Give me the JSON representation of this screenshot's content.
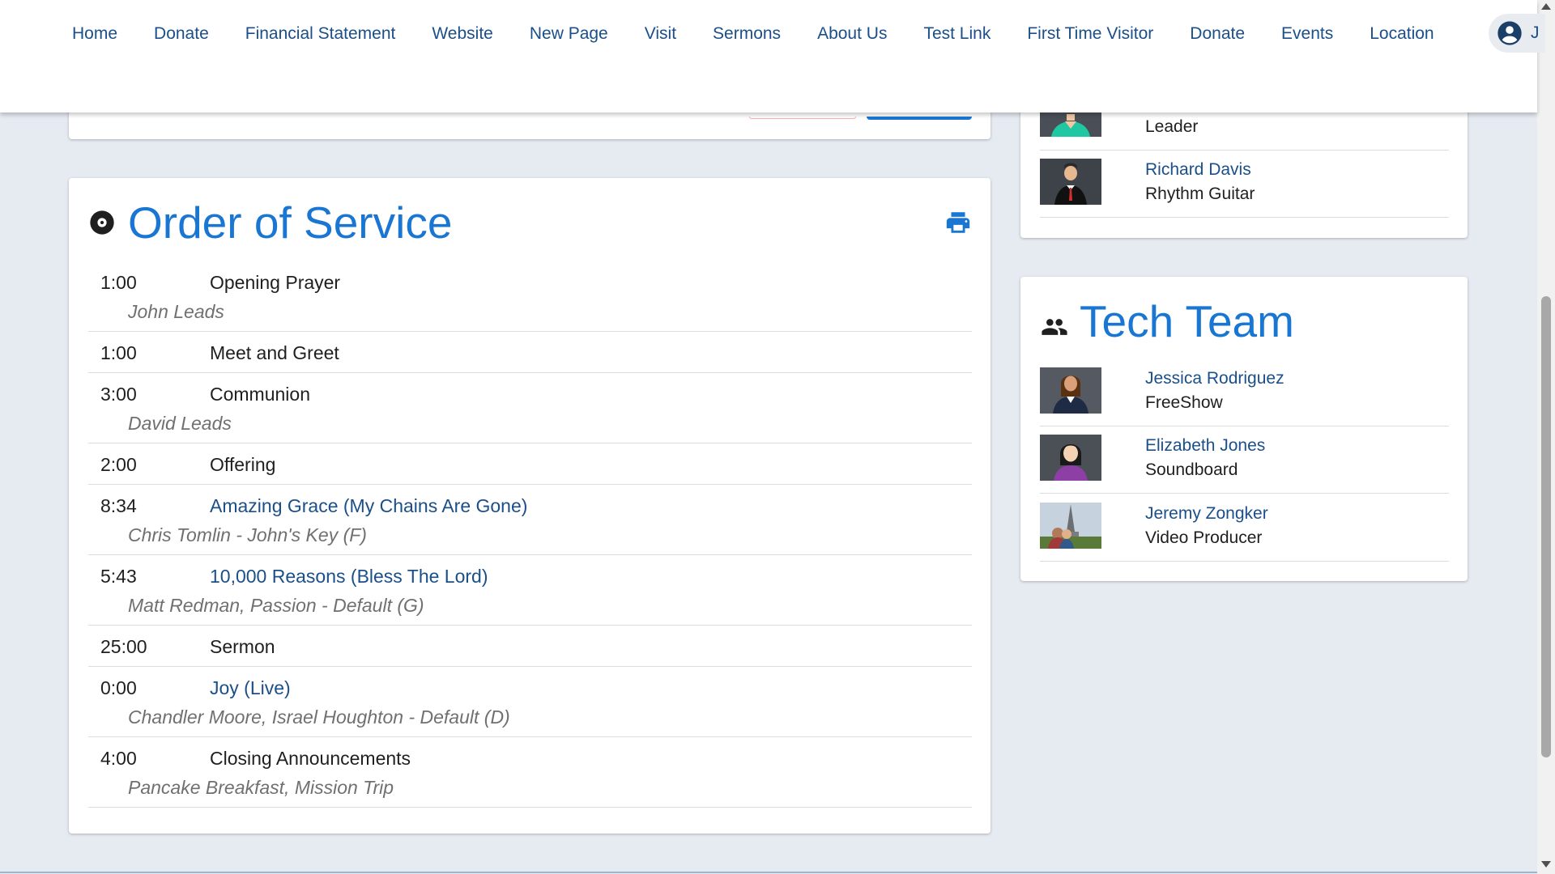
{
  "nav": {
    "items": [
      {
        "label": "Home"
      },
      {
        "label": "Donate"
      },
      {
        "label": "Financial Statement"
      },
      {
        "label": "Website"
      },
      {
        "label": "New Page"
      },
      {
        "label": "Visit"
      },
      {
        "label": "Sermons"
      },
      {
        "label": "About Us"
      },
      {
        "label": "Test Link"
      },
      {
        "label": "First Time Visitor"
      },
      {
        "label": "Donate"
      },
      {
        "label": "Events"
      },
      {
        "label": "Location"
      }
    ],
    "user_initial": "J"
  },
  "order_of_service": {
    "title": "Order of Service",
    "icon": "disc-icon",
    "print_icon": "printer-icon",
    "items": [
      {
        "time": "1:00",
        "label": "Opening Prayer",
        "sub": "John Leads",
        "is_song": false
      },
      {
        "time": "1:00",
        "label": "Meet and Greet",
        "sub": "",
        "is_song": false
      },
      {
        "time": "3:00",
        "label": "Communion",
        "sub": "David Leads",
        "is_song": false
      },
      {
        "time": "2:00",
        "label": "Offering",
        "sub": "",
        "is_song": false
      },
      {
        "time": "8:34",
        "label": "Amazing Grace (My Chains Are Gone)",
        "sub": "Chris Tomlin - John's Key (F)",
        "is_song": true
      },
      {
        "time": "5:43",
        "label": "10,000 Reasons (Bless The Lord)",
        "sub": "Matt Redman, Passion - Default (G)",
        "is_song": true
      },
      {
        "time": "25:00",
        "label": "Sermon",
        "sub": "",
        "is_song": false
      },
      {
        "time": "0:00",
        "label": "Joy (Live)",
        "sub": "Chandler Moore, Israel Houghton - Default (D)",
        "is_song": true
      },
      {
        "time": "4:00",
        "label": "Closing Announcements",
        "sub": "Pancake Breakfast, Mission Trip",
        "is_song": false
      }
    ]
  },
  "worship_team": {
    "members": [
      {
        "name": "",
        "role": "Leader"
      },
      {
        "name": "Richard Davis",
        "role": "Rhythm Guitar"
      }
    ]
  },
  "tech_team": {
    "title": "Tech Team",
    "icon": "people-icon",
    "members": [
      {
        "name": "Jessica Rodriguez",
        "role": "FreeShow"
      },
      {
        "name": "Elizabeth Jones",
        "role": "Soundboard"
      },
      {
        "name": "Jeremy Zongker",
        "role": "Video Producer"
      }
    ]
  },
  "colors": {
    "accent": "#1976d2",
    "link": "#1b4f89",
    "background": "#e6eaf1",
    "muted_text": "#707070"
  }
}
